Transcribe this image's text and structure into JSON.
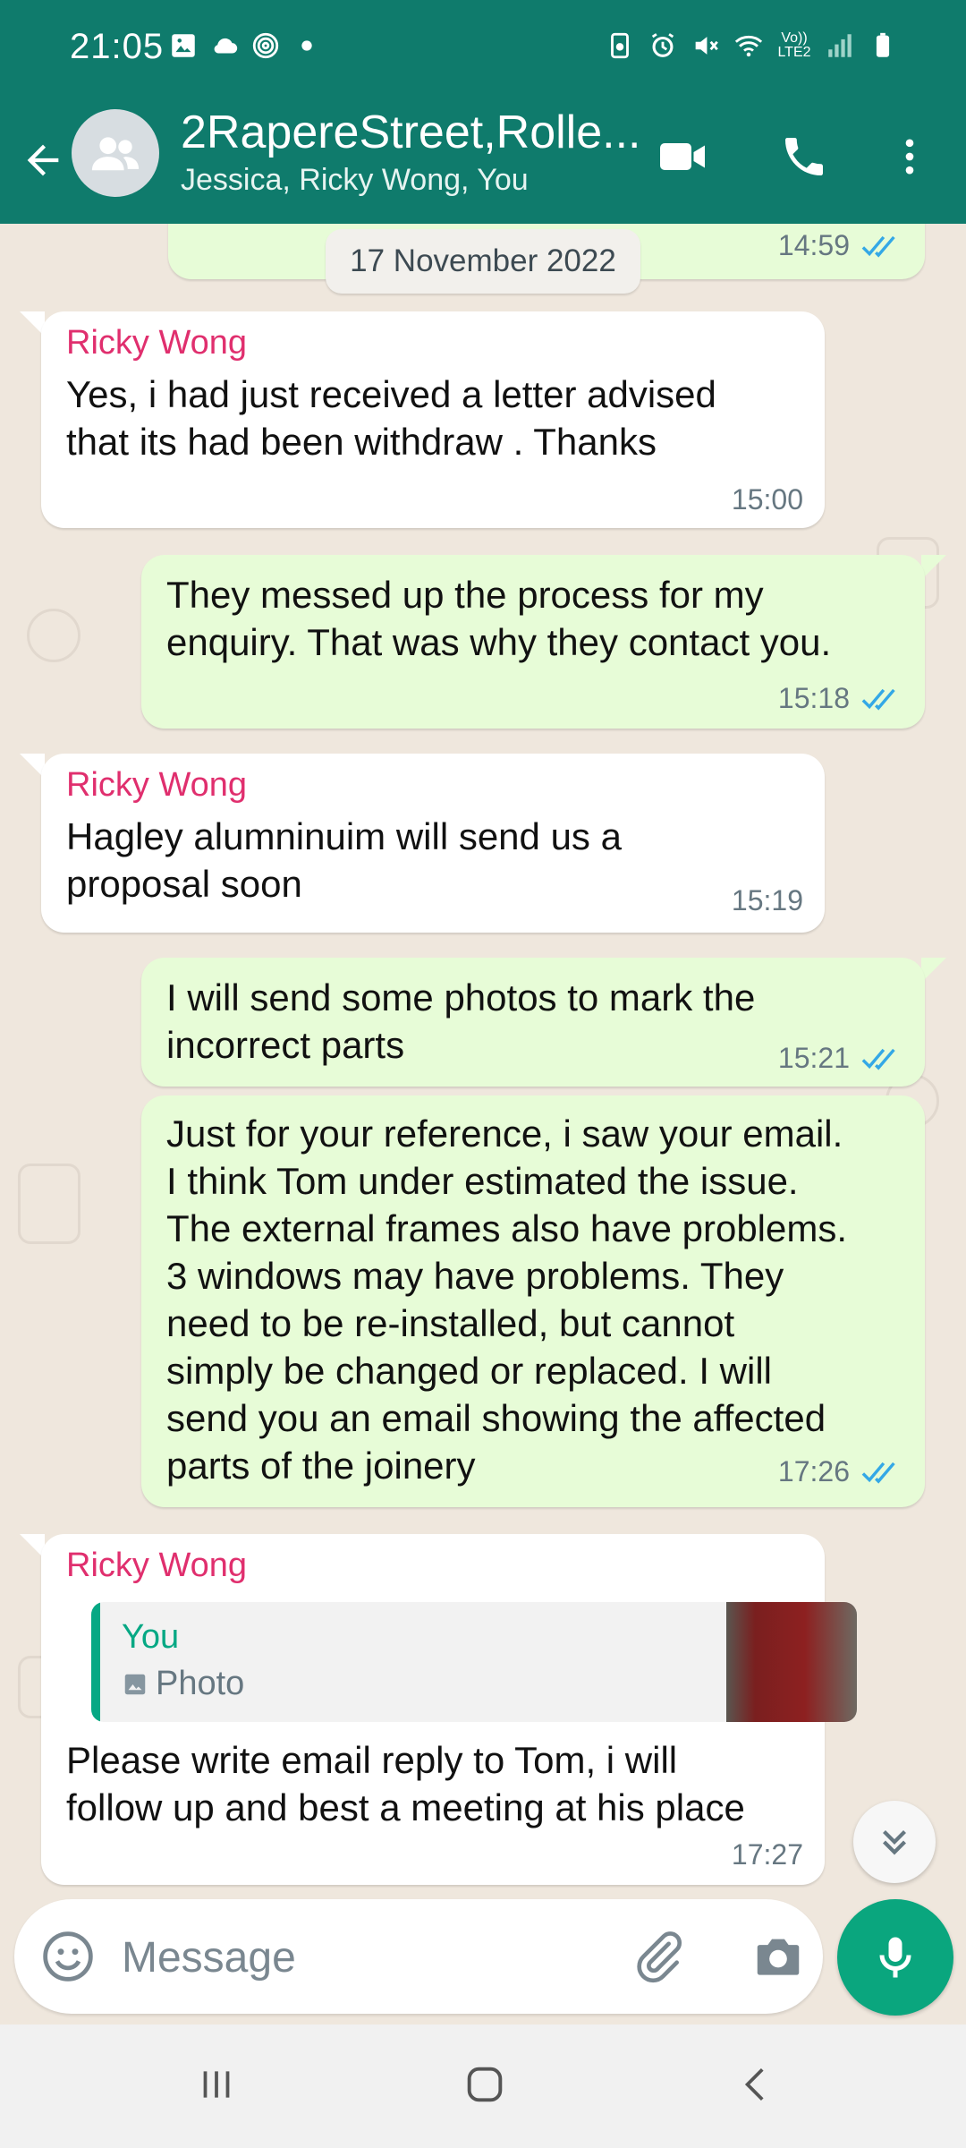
{
  "status_bar": {
    "time": "21:05",
    "left_icons": [
      "image-icon",
      "cloud-icon",
      "fingerprint-icon",
      "dot-icon"
    ],
    "right_icons": [
      "battery-saver-icon",
      "alarm-icon",
      "mute-icon",
      "wifi-icon",
      "volte-icon",
      "signal-icon",
      "battery-icon"
    ],
    "volte_label": "Vo)) LTE2"
  },
  "header": {
    "title": "2RapereStreet,Rolle...",
    "subtitle": "Jessica, Ricky Wong, You",
    "icons": [
      "back-arrow-icon",
      "group-avatar-icon",
      "video-call-icon",
      "phone-icon",
      "more-vert-icon"
    ]
  },
  "chat": {
    "date_chip": "17 November 2022",
    "messages": [
      {
        "direction": "out",
        "text": "",
        "time": "14:59",
        "read": true
      },
      {
        "direction": "in",
        "sender": "Ricky Wong",
        "text_lines": [
          "Yes, i had just received a letter advised",
          "that its had been withdraw . Thanks"
        ],
        "time": "15:00"
      },
      {
        "direction": "out",
        "text_lines": [
          "They messed up the process for my",
          "enquiry. That was why they contact you."
        ],
        "time": "15:18",
        "read": true
      },
      {
        "direction": "in",
        "sender": "Ricky Wong",
        "text_lines": [
          "Hagley alumninuim will send us a",
          "proposal soon"
        ],
        "time": "15:19"
      },
      {
        "direction": "out",
        "text_lines": [
          "I will send some photos to mark the",
          "incorrect parts"
        ],
        "time": "15:21",
        "read": true
      },
      {
        "direction": "out",
        "text_lines": [
          "Just for your reference, i saw your email.",
          "I think Tom under estimated the issue.",
          "The external frames also have problems.",
          "3 windows may have problems. They",
          "need to be re-installed, but cannot",
          "simply be changed or replaced. I will",
          "send you an email showing the affected",
          "parts of the joinery"
        ],
        "time": "17:26",
        "read": true
      },
      {
        "direction": "in",
        "sender": "Ricky Wong",
        "quote": {
          "name": "You",
          "type_label": "Photo"
        },
        "text_lines": [
          "Please write email reply to Tom, i will",
          "follow up and best a meeting at his place"
        ],
        "time": "17:27"
      }
    ]
  },
  "input": {
    "placeholder": "Message",
    "icons": [
      "emoji-icon",
      "attach-icon",
      "camera-icon",
      "mic-icon"
    ]
  },
  "nav": {
    "icons": [
      "recents-icon",
      "home-icon",
      "back-icon"
    ]
  },
  "colors": {
    "header": "#0f7b6c",
    "wallpaper": "#efe7dd",
    "outgoing_bubble": "#e7fcd7",
    "incoming_bubble": "#ffffff",
    "sender_name": "#e02f6e",
    "read_ticks": "#34a8e6",
    "accent": "#0aa67e"
  }
}
